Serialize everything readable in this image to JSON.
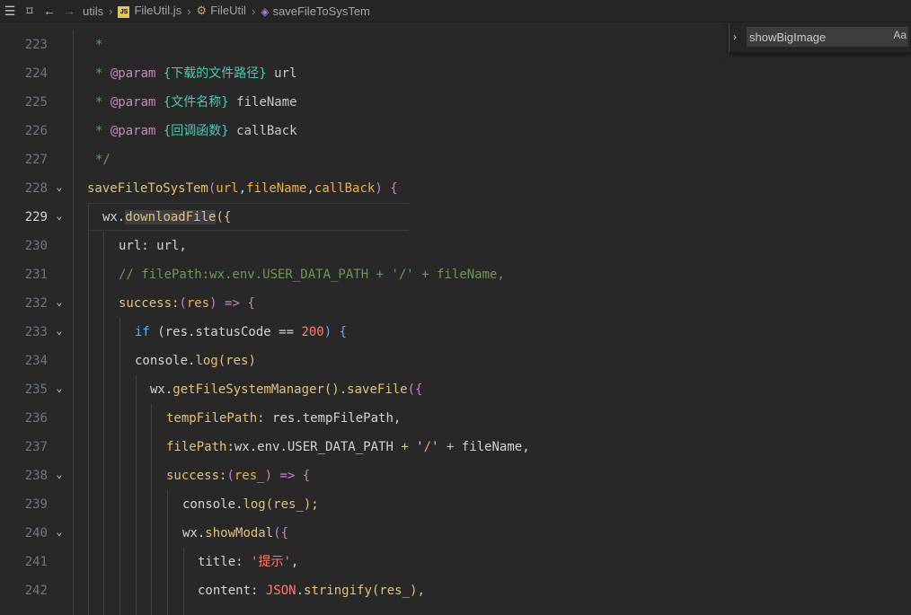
{
  "breadcrumb": {
    "folder": "utils",
    "file": "FileUtil.js",
    "class_name": "FileUtil",
    "method": "saveFileToSysTem"
  },
  "find": {
    "value": "showBigImage",
    "match_case_label": "Aa"
  },
  "colors": {
    "comment": "#6a9955",
    "tag": "#c586c0",
    "type": "#4ec9b0",
    "function": "#e5c07b",
    "number": "#ff7b72",
    "string": "#f0a070",
    "background": "#282828"
  },
  "lines": [
    {
      "n": "223",
      "tokens": [
        {
          "t": "*",
          "c": "c-com"
        }
      ]
    },
    {
      "n": "224",
      "tokens": [
        {
          "t": "* ",
          "c": "c-com"
        },
        {
          "t": "@param",
          "c": "c-tag"
        },
        {
          "t": " ",
          "c": ""
        },
        {
          "t": "{下载的文件路径}",
          "c": "c-type"
        },
        {
          "t": " url",
          "c": "c-prop"
        }
      ]
    },
    {
      "n": "225",
      "tokens": [
        {
          "t": "* ",
          "c": "c-com"
        },
        {
          "t": "@param",
          "c": "c-tag"
        },
        {
          "t": " ",
          "c": ""
        },
        {
          "t": "{文件名称}",
          "c": "c-type"
        },
        {
          "t": " fileName",
          "c": "c-prop"
        }
      ]
    },
    {
      "n": "226",
      "tokens": [
        {
          "t": "* ",
          "c": "c-com"
        },
        {
          "t": "@param",
          "c": "c-tag"
        },
        {
          "t": " ",
          "c": ""
        },
        {
          "t": "{回调函数}",
          "c": "c-type"
        },
        {
          "t": " callBack",
          "c": "c-prop"
        }
      ]
    },
    {
      "n": "227",
      "tokens": [
        {
          "t": "*/",
          "c": "c-com"
        }
      ]
    },
    {
      "n": "228",
      "tokens": [
        {
          "t": "saveFileToSysTem",
          "c": "c-fn"
        },
        {
          "t": "(",
          "c": "c-bracket"
        },
        {
          "t": "url",
          "c": "c-self"
        },
        {
          "t": ",",
          "c": ""
        },
        {
          "t": "fileName",
          "c": "c-self"
        },
        {
          "t": ",",
          "c": ""
        },
        {
          "t": "callBack",
          "c": "c-self"
        },
        {
          "t": ") {",
          "c": "c-bracket"
        }
      ]
    },
    {
      "n": "229",
      "tokens": [
        {
          "t": "wx.",
          "c": ""
        },
        {
          "t": "downloadFile",
          "c": "c-fn hl-word"
        },
        {
          "t": "({",
          "c": "c-fn"
        }
      ]
    },
    {
      "n": "230",
      "tokens": [
        {
          "t": "url: url,",
          "c": ""
        }
      ]
    },
    {
      "n": "231",
      "tokens": [
        {
          "t": "// filePath:wx.env.USER_DATA_PATH + '/' + fileName,",
          "c": "c-com"
        }
      ]
    },
    {
      "n": "232",
      "tokens": [
        {
          "t": "success:",
          "c": "c-fn"
        },
        {
          "t": "(",
          "c": "c-bracket"
        },
        {
          "t": "res",
          "c": "c-self"
        },
        {
          "t": ") => {",
          "c": "c-bracket"
        }
      ]
    },
    {
      "n": "233",
      "tokens": [
        {
          "t": "if",
          "c": "c-kw"
        },
        {
          "t": " (res.statusCode == ",
          "c": ""
        },
        {
          "t": "200",
          "c": "c-num"
        },
        {
          "t": ") {",
          "c": "c-kw"
        }
      ]
    },
    {
      "n": "234",
      "tokens": [
        {
          "t": "console.",
          "c": ""
        },
        {
          "t": "log",
          "c": "c-fn"
        },
        {
          "t": "(res)",
          "c": "c-fn"
        }
      ]
    },
    {
      "n": "235",
      "tokens": [
        {
          "t": "wx.",
          "c": ""
        },
        {
          "t": "getFileSystemManager",
          "c": "c-fn"
        },
        {
          "t": "().",
          "c": "c-fn"
        },
        {
          "t": "saveFile",
          "c": "c-fn"
        },
        {
          "t": "({",
          "c": "c-bracket"
        }
      ]
    },
    {
      "n": "236",
      "tokens": [
        {
          "t": "tempFilePath",
          "c": "c-fn"
        },
        {
          "t": ": res.tempFilePath,",
          "c": ""
        }
      ]
    },
    {
      "n": "237",
      "tokens": [
        {
          "t": "filePath",
          "c": "c-fn"
        },
        {
          "t": ":wx.env.USER_DATA_PATH ",
          "c": ""
        },
        {
          "t": "+",
          "c": "c-fn"
        },
        {
          "t": " '",
          "c": ""
        },
        {
          "t": "/",
          "c": "c-str"
        },
        {
          "t": "' ",
          "c": ""
        },
        {
          "t": "+",
          "c": "c-fn"
        },
        {
          "t": " fileName,",
          "c": ""
        }
      ]
    },
    {
      "n": "238",
      "tokens": [
        {
          "t": "success:",
          "c": "c-fn"
        },
        {
          "t": "(",
          "c": "c-bracket"
        },
        {
          "t": "res_",
          "c": "c-self"
        },
        {
          "t": ") => {",
          "c": "c-bracket"
        }
      ]
    },
    {
      "n": "239",
      "tokens": [
        {
          "t": "console.",
          "c": ""
        },
        {
          "t": "log",
          "c": "c-fn"
        },
        {
          "t": "(res_);",
          "c": "c-fn"
        }
      ]
    },
    {
      "n": "240",
      "tokens": [
        {
          "t": "wx.",
          "c": ""
        },
        {
          "t": "showModal",
          "c": "c-fn"
        },
        {
          "t": "({",
          "c": "c-bracket"
        }
      ]
    },
    {
      "n": "241",
      "tokens": [
        {
          "t": "title: ",
          "c": ""
        },
        {
          "t": "'提示'",
          "c": "c-num"
        },
        {
          "t": ",",
          "c": ""
        }
      ]
    },
    {
      "n": "242",
      "tokens": [
        {
          "t": "content: ",
          "c": ""
        },
        {
          "t": "JSON",
          "c": "c-num"
        },
        {
          "t": ".",
          "c": ""
        },
        {
          "t": "stringify",
          "c": "c-fn"
        },
        {
          "t": "(res_),",
          "c": "c-fn"
        }
      ]
    }
  ]
}
